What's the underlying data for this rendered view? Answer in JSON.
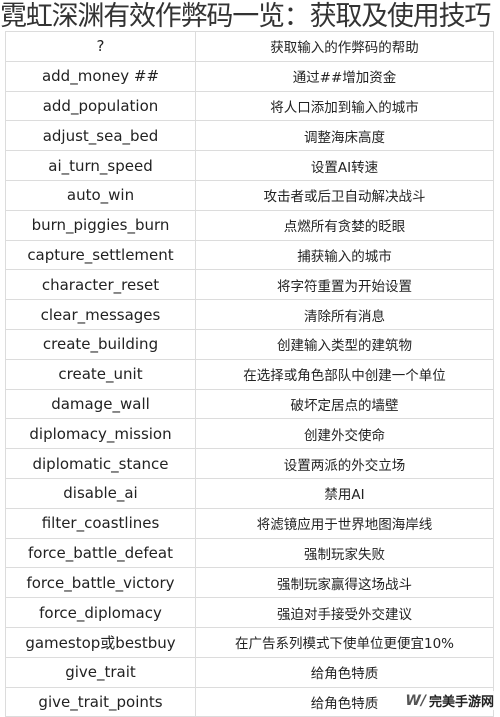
{
  "title": "霓虹深渊有效作弊码一览：获取及使用技巧",
  "rows": [
    {
      "code": "?",
      "desc": "获取输入的作弊码的帮助"
    },
    {
      "code": "add_money ##",
      "desc": "通过##增加资金"
    },
    {
      "code": "add_population",
      "desc": "将人口添加到输入的城市"
    },
    {
      "code": "adjust_sea_bed",
      "desc": "调整海床高度"
    },
    {
      "code": "ai_turn_speed",
      "desc": "设置AI转速"
    },
    {
      "code": "auto_win",
      "desc": "攻击者或后卫自动解决战斗"
    },
    {
      "code": "burn_piggies_burn",
      "desc": "点燃所有贪婪的眨眼"
    },
    {
      "code": "capture_settlement",
      "desc": "捕获输入的城市"
    },
    {
      "code": "character_reset",
      "desc": "将字符重置为开始设置"
    },
    {
      "code": "clear_messages",
      "desc": "清除所有消息"
    },
    {
      "code": "create_building",
      "desc": "创建输入类型的建筑物"
    },
    {
      "code": "create_unit",
      "desc": "在选择或角色部队中创建一个单位"
    },
    {
      "code": "damage_wall",
      "desc": "破坏定居点的墙壁"
    },
    {
      "code": "diplomacy_mission",
      "desc": "创建外交使命"
    },
    {
      "code": "diplomatic_stance",
      "desc": "设置两派的外交立场"
    },
    {
      "code": "disable_ai",
      "desc": "禁用AI"
    },
    {
      "code": "filter_coastlines",
      "desc": "将滤镜应用于世界地图海岸线"
    },
    {
      "code": "force_battle_defeat",
      "desc": "强制玩家失败"
    },
    {
      "code": "force_battle_victory",
      "desc": "强制玩家赢得这场战斗"
    },
    {
      "code": "force_diplomacy",
      "desc": "强迫对手接受外交建议"
    },
    {
      "code": "gamestop或bestbuy",
      "desc": "在广告系列模式下使单位更便宜10%"
    },
    {
      "code": "give_trait",
      "desc": "给角色特质"
    },
    {
      "code": "give_trait_points",
      "desc": "给角色特质"
    }
  ],
  "watermark": {
    "text": "完美手游网",
    "icon": "wanmei-logo-icon"
  }
}
